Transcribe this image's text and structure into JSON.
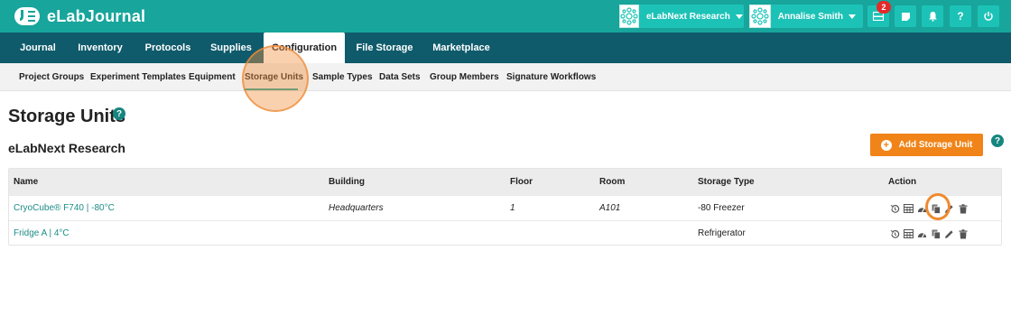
{
  "app": {
    "name": "eLabJournal"
  },
  "topbar": {
    "group_select": "eLabNext Research",
    "user_select": "Annalise Smith",
    "notification_count": "2"
  },
  "main_nav": [
    {
      "label": "Journal"
    },
    {
      "label": "Inventory"
    },
    {
      "label": "Protocols"
    },
    {
      "label": "Supplies"
    },
    {
      "label": "Configuration",
      "active": true
    },
    {
      "label": "File Storage"
    },
    {
      "label": "Marketplace"
    }
  ],
  "sub_nav": [
    {
      "label": "Project Groups"
    },
    {
      "label": "Experiment Templates"
    },
    {
      "label": "Equipment"
    },
    {
      "label": "Storage Units",
      "active": true
    },
    {
      "label": "Sample Types"
    },
    {
      "label": "Data Sets"
    },
    {
      "label": "Group Members"
    },
    {
      "label": "Signature Workflows"
    }
  ],
  "page": {
    "title": "Storage Units",
    "subtitle": "eLabNext Research",
    "add_button": "Add Storage Unit"
  },
  "table": {
    "columns": [
      "Name",
      "Building",
      "Floor",
      "Room",
      "Storage Type",
      "Action"
    ],
    "rows": [
      {
        "name": "CryoCube® F740 | -80°C",
        "building": "Headquarters",
        "floor": "1",
        "room": "A101",
        "storage_type": "-80 Freezer"
      },
      {
        "name": "Fridge A | 4°C",
        "building": "",
        "floor": "",
        "room": "",
        "storage_type": "Refrigerator"
      }
    ]
  },
  "colors": {
    "topbar": "#17a59c",
    "main_nav": "#0f5b6b",
    "accent_orange": "#f08419",
    "link": "#1d8d86"
  },
  "icons": [
    "history-icon",
    "grid-icon",
    "dashboard-icon",
    "copy-icon",
    "edit-icon",
    "trash-icon"
  ]
}
